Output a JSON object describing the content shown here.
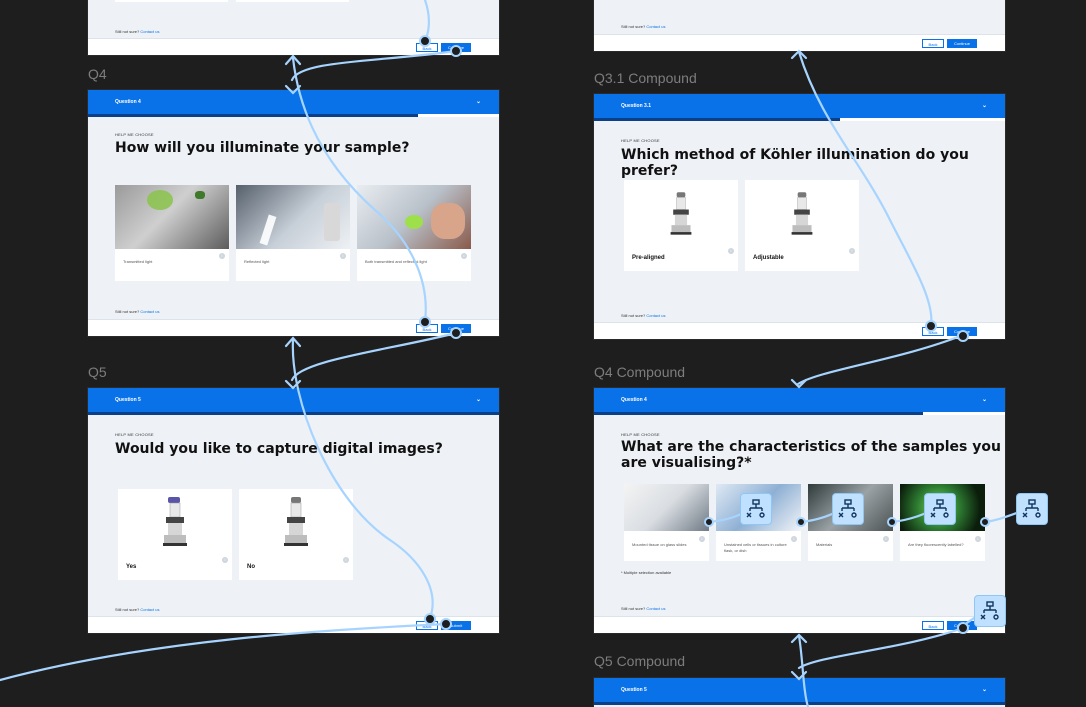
{
  "labels": {
    "q4": "Q4",
    "q5": "Q5",
    "q31c": "Q3.1 Compound",
    "q4c": "Q4 Compound",
    "q5c": "Q5 Compound"
  },
  "common": {
    "eyebrow": "HELP ME CHOOSE",
    "unsure_text": "Still not sure?",
    "contact": "Contact us",
    "back": "Back",
    "continue": "Continue",
    "submit": "Submit"
  },
  "q4": {
    "header": "Question 4",
    "title": "How will you illuminate your sample?",
    "cards": [
      "Transmitted light",
      "Reflected light",
      "Both transmitted and reflected light"
    ]
  },
  "q5": {
    "header": "Question 5",
    "title": "Would you like to capture digital images?",
    "cards": [
      "Yes",
      "No"
    ]
  },
  "q31c": {
    "header": "Question 3.1",
    "title_l1": "Which method of Köhler illumination do you",
    "title_l2": "prefer?",
    "cards": [
      "Pre-aligned",
      "Adjustable"
    ]
  },
  "q4c": {
    "header": "Question 4",
    "title_l1": "What are the characteristics of the samples you",
    "title_l2": "are visualising?*",
    "cards": [
      "Mounted tissue on glass slides",
      "Unstained cells or tissues in culture flask, or dish",
      "Materials",
      "Are they fluorescently labelled?"
    ],
    "note": "* Multiple selection available"
  },
  "q5c": {
    "header": "Question 5"
  },
  "colors": {
    "accent": "#0a72e8",
    "canvas": "#1e1e1e",
    "connector": "#a7d4ff"
  }
}
